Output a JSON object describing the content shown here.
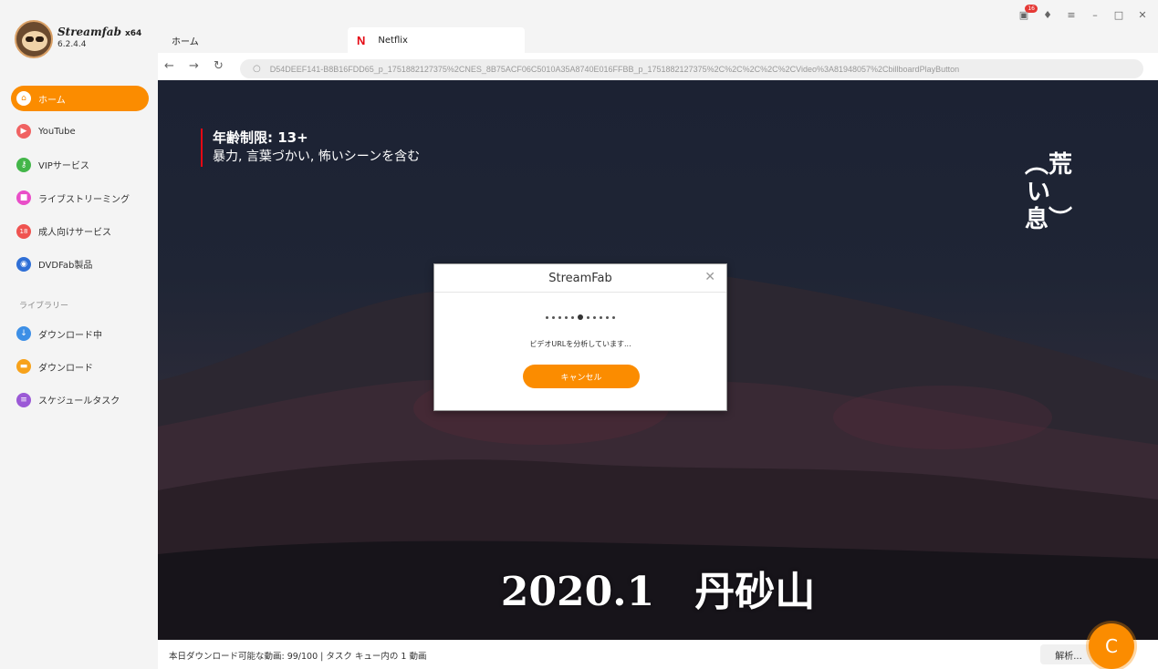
{
  "app": {
    "name": "Streamfab",
    "arch": "x64",
    "version": "6.2.4.4",
    "badge_count": "16"
  },
  "sidebar": {
    "items": [
      {
        "label": "ホーム",
        "icon": "home-icon",
        "color": "#fb8c00",
        "active": true
      },
      {
        "label": "YouTube",
        "icon": "youtube-icon",
        "color": "#f06262"
      },
      {
        "label": "VIPサービス",
        "icon": "key-icon",
        "color": "#43b649"
      },
      {
        "label": "ライブストリーミング",
        "icon": "camera-icon",
        "color": "#e94ec8"
      },
      {
        "label": "成人向けサービス",
        "icon": "adult-icon",
        "color": "#ef5350"
      },
      {
        "label": "DVDFab製品",
        "icon": "dvdfab-icon",
        "color": "#2f6fd6"
      }
    ],
    "library_label": "ライブラリー",
    "library_items": [
      {
        "label": "ダウンロード中",
        "icon": "download-icon",
        "color": "#3d8fe6"
      },
      {
        "label": "ダウンロード",
        "icon": "folder-icon",
        "color": "#f7a21b"
      },
      {
        "label": "スケジュールタスク",
        "icon": "schedule-icon",
        "color": "#9b59d6"
      }
    ]
  },
  "tabs": {
    "home_label": "ホーム",
    "netflix_label": "Netflix"
  },
  "address": {
    "url": "D54DEEF141-B8B16FDD65_p_1751882127375%2CNES_8B75ACF06C5010A35A8740E016FFBB_p_1751882127375%2C%2C%2C%2C%2CVideo%3A81948057%2CbillboardPlayButton"
  },
  "video": {
    "rating_title": "年齢制限: 13+",
    "rating_desc": "暴力, 言葉づかい, 怖いシーンを含む",
    "vertical_text": "︵荒い息︶",
    "caption": "2020.1　丹砂山"
  },
  "dialog": {
    "title": "StreamFab",
    "message": "ビデオURLを分析しています...",
    "cancel_label": "キャンセル"
  },
  "status": {
    "text": "本日ダウンロード可能な動画: 99/100 | タスク キュー内の 1 動画",
    "analyze_label": "解析..."
  }
}
